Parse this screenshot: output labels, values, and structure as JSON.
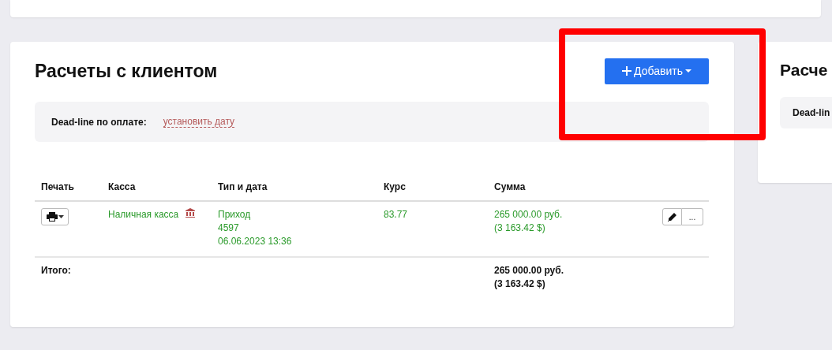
{
  "panel": {
    "title": "Расчеты с клиентом",
    "add_button": "Добавить",
    "deadline": {
      "label": "Dead-line по оплате:",
      "link": "установить дату"
    },
    "table": {
      "columns": [
        "Печать",
        "Касса",
        "Тип и дата",
        "Курс",
        "Сумма"
      ],
      "rows": [
        {
          "cashbox": "Наличная касса",
          "type": "Приход",
          "number": "4597",
          "date": "06.06.2023 13:36",
          "rate": "83.77",
          "amount": "265 000.00 руб.",
          "amount_usd": "(3 163.42 $)",
          "more": "..."
        }
      ],
      "total": {
        "label": "Итого:",
        "amount": "265 000.00 руб.",
        "amount_usd": "(3 163.42 $)"
      }
    }
  },
  "side_panel": {
    "title": "Расче",
    "deadline_label": "Dead-lin"
  }
}
